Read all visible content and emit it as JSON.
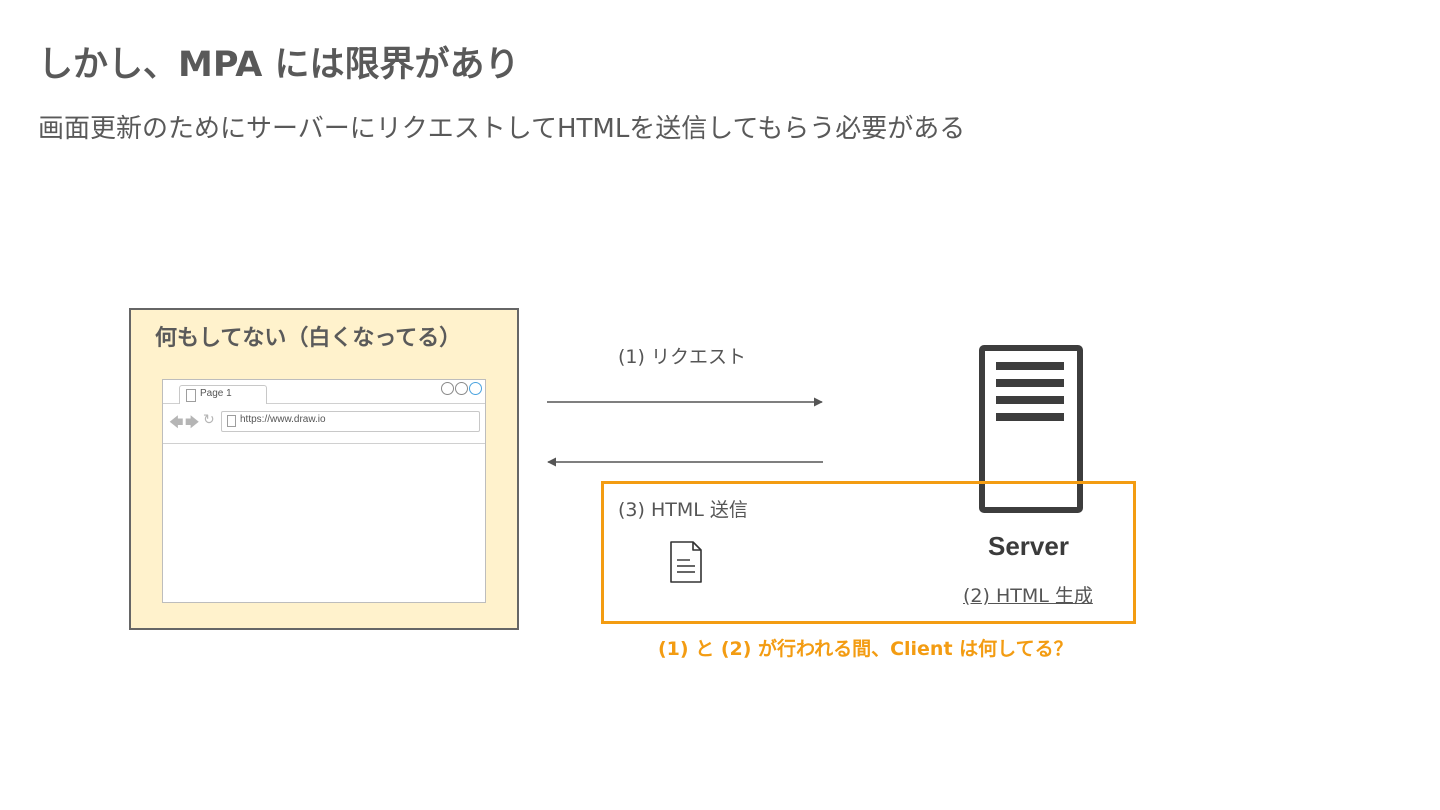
{
  "slide": {
    "title": "しかし、MPA には限界があり",
    "subtitle": "画面更新のためにサーバーにリクエストしてHTMLを送信してもらう必要がある"
  },
  "client": {
    "label": "何もしてない（白くなってる）",
    "browser": {
      "tab_label": "Page 1",
      "url": "https://www.draw.io",
      "nav_icons": [
        "back-arrow-icon",
        "forward-arrow-icon",
        "reload-icon"
      ]
    }
  },
  "flow": {
    "request_label": "(1) リクエスト",
    "response_label": "(3) HTML 送信",
    "generate_label": "(2) HTML 生成"
  },
  "server": {
    "label": "Server",
    "icon": "server-rack-icon"
  },
  "document_icon": "document-icon",
  "question": "(1) と (2) が行われる間、Client は何してる？",
  "colors": {
    "accent": "#f39c12",
    "client_fill": "#fff2cc",
    "text": "#595959",
    "server": "#3b3b3b"
  }
}
